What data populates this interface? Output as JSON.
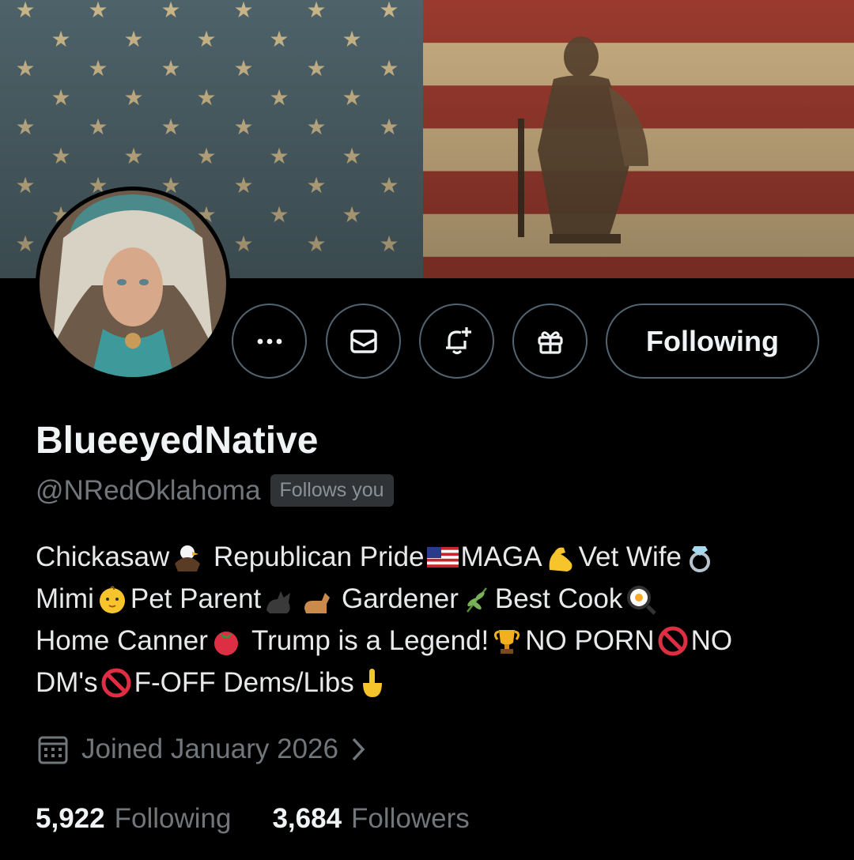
{
  "profile": {
    "display_name": "BlueeyedNative",
    "handle": "@NRedOklahoma",
    "follows_you_badge": "Follows you",
    "bio_lines": [
      [
        "Chickasaw",
        "eagle-emoji",
        "Republican Pride",
        "us-flag-emoji",
        "MAGA",
        "flexed-biceps-emoji",
        "Vet Wife",
        "ring-emoji"
      ],
      [
        "Mimi",
        "baby-emoji",
        "Pet Parent",
        "black-cat-emoji",
        "dog-emoji",
        "Gardener",
        "herb-emoji",
        "Best Cook",
        "cooking-egg-emoji"
      ],
      [
        "Home Canner",
        "tomato-emoji",
        "Trump is a Legend!",
        "trophy-emoji",
        "NO PORN",
        "prohibited-emoji",
        "NO"
      ],
      [
        "DM's",
        "prohibited-emoji",
        "F-OFF Dems/Libs",
        "middle-finger-emoji"
      ]
    ],
    "joined": "Joined January 2026"
  },
  "actions": {
    "more": "more-icon",
    "message": "mail-icon",
    "notify": "bell-plus-icon",
    "gift": "gift-icon",
    "follow_label": "Following"
  },
  "stats": {
    "following_count": "5,922",
    "following_label": "Following",
    "followers_count": "3,684",
    "followers_label": "Followers"
  },
  "colors": {
    "background": "#000000",
    "primary_text": "#e7e9ea",
    "secondary_text": "#71767b",
    "border": "#536471",
    "badge_bg": "#2f3336"
  }
}
